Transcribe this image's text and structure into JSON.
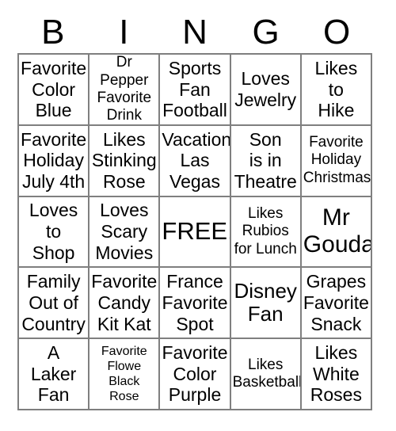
{
  "card": {
    "header_letters": [
      "B",
      "I",
      "N",
      "G",
      "O"
    ],
    "rows": [
      [
        {
          "text": "Favorite\nColor\nBlue",
          "size": "md"
        },
        {
          "text": "Dr Pepper\nFavorite\nDrink",
          "size": "sm"
        },
        {
          "text": "Sports\nFan\nFootball",
          "size": "md"
        },
        {
          "text": "Loves\nJewelry",
          "size": "md"
        },
        {
          "text": "Likes\nto\nHike",
          "size": "md"
        }
      ],
      [
        {
          "text": "Favorite\nHoliday\nJuly 4th",
          "size": "md"
        },
        {
          "text": "Likes\nStinking\nRose",
          "size": "md"
        },
        {
          "text": "Vacation\nLas\nVegas",
          "size": "md"
        },
        {
          "text": "Son\nis in\nTheatre",
          "size": "md"
        },
        {
          "text": "Favorite\nHoliday\nChristmas",
          "size": "sm"
        }
      ],
      [
        {
          "text": "Loves\nto\nShop",
          "size": "md"
        },
        {
          "text": "Loves\nScary\nMovies",
          "size": "md"
        },
        {
          "text": "FREE!",
          "size": "free"
        },
        {
          "text": "Likes\nRubios\nfor Lunch",
          "size": "sm"
        },
        {
          "text": "Mr\nGouda",
          "size": "xl"
        }
      ],
      [
        {
          "text": "Family\nOut of\nCountry",
          "size": "md"
        },
        {
          "text": "Favorite\nCandy\nKit Kat",
          "size": "md"
        },
        {
          "text": "France\nFavorite\nSpot",
          "size": "md"
        },
        {
          "text": "Disney\nFan",
          "size": "lg"
        },
        {
          "text": "Grapes\nFavorite\nSnack",
          "size": "md"
        }
      ],
      [
        {
          "text": "A\nLaker\nFan",
          "size": "md"
        },
        {
          "text": "Favorite\nFlowe\nBlack\nRose",
          "size": "xs"
        },
        {
          "text": "Favorite\nColor\nPurple",
          "size": "md"
        },
        {
          "text": "Likes\nBasketball",
          "size": "sm"
        },
        {
          "text": "Likes\nWhite\nRoses",
          "size": "md"
        }
      ]
    ]
  },
  "style": {
    "border_color": "#7f7f7f",
    "text_color": "#000000",
    "background_color": "#ffffff"
  }
}
